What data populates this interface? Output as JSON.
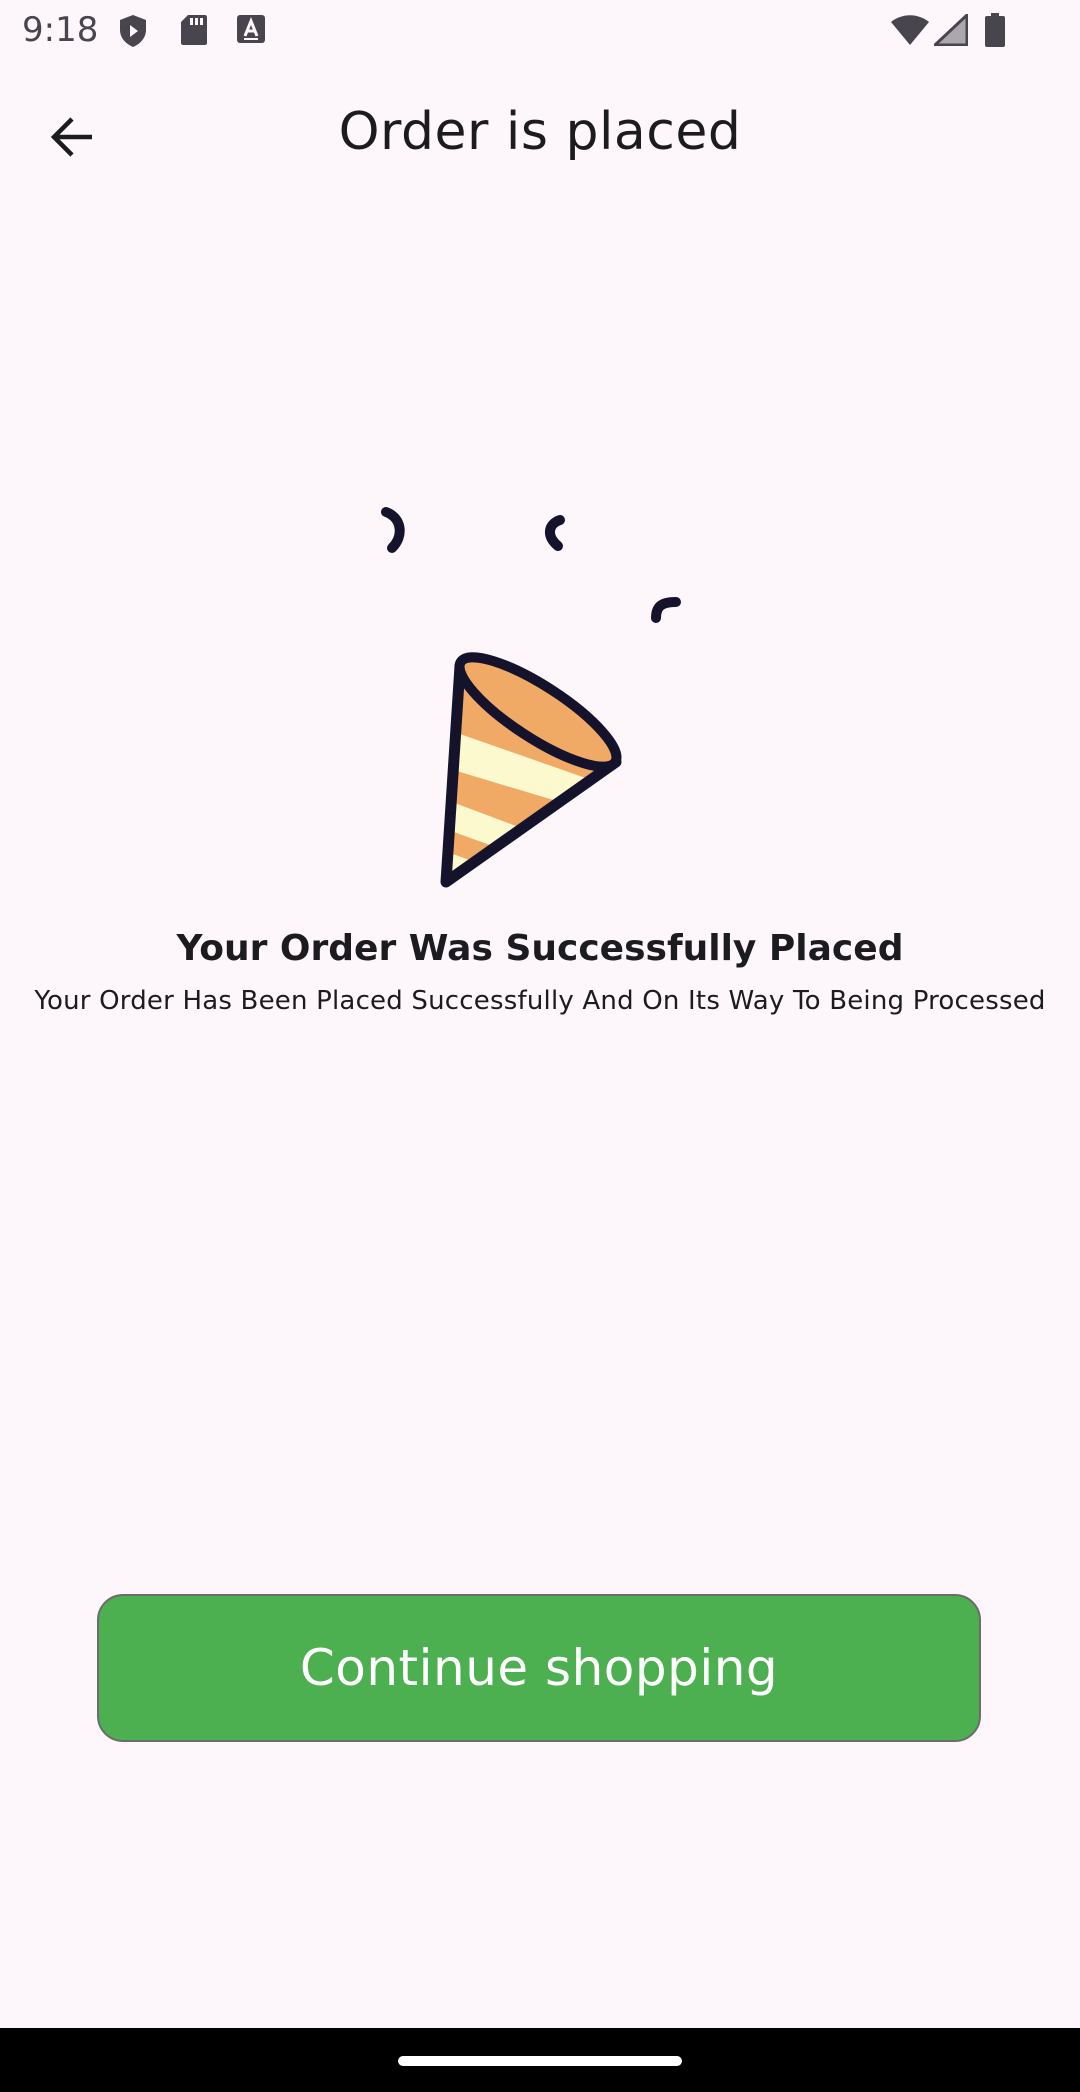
{
  "status_bar": {
    "time": "9:18",
    "left_icons": [
      "shield-play-icon",
      "sd-card-icon",
      "keyboard-a-icon"
    ],
    "right_icons": [
      "wifi-icon",
      "cell-signal-icon",
      "battery-icon"
    ]
  },
  "app_bar": {
    "back_icon": "arrow-back-icon",
    "title": "Order is placed"
  },
  "illustration": {
    "icon": "party-popper-icon",
    "colors": {
      "outline": "#14132b",
      "stripe_orange": "#f0aa66",
      "stripe_cream": "#fdf9cf"
    }
  },
  "message": {
    "headline": "Your Order Was Successfully Placed",
    "subline": "Your Order Has Been Placed Successfully And On Its Way To Being Processed"
  },
  "actions": {
    "continue_label": "Continue shopping",
    "continue_color": "#4caf50"
  },
  "nav_bar": {
    "home_indicator": "home-indicator"
  }
}
